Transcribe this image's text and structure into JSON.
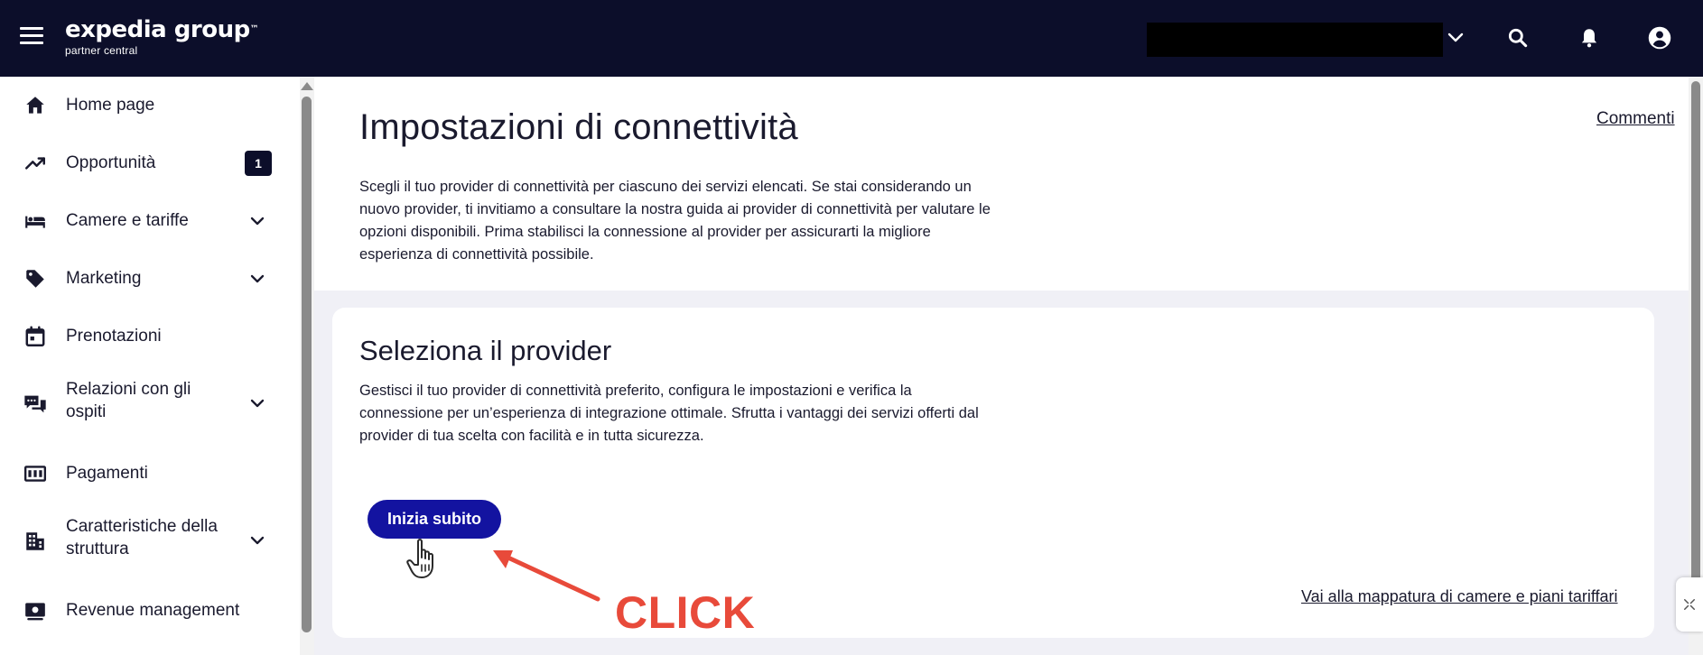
{
  "topbar": {
    "logo_main": "expedia group",
    "logo_tm": "™",
    "logo_sub": "partner central"
  },
  "sidebar": {
    "items": [
      {
        "label": "Home page",
        "icon": "home-icon"
      },
      {
        "label": "Opportunità",
        "icon": "trending-up-icon",
        "badge": "1"
      },
      {
        "label": "Camere e tariffe",
        "icon": "bed-icon",
        "expandable": true
      },
      {
        "label": "Marketing",
        "icon": "tag-icon",
        "expandable": true
      },
      {
        "label": "Prenotazioni",
        "icon": "calendar-icon"
      },
      {
        "label": "Relazioni con gli ospiti",
        "label_line1": "Relazioni con gli",
        "label_line2": "ospiti",
        "icon": "chat-icon",
        "expandable": true
      },
      {
        "label": "Pagamenti",
        "icon": "payments-icon"
      },
      {
        "label": "Caratteristiche della struttura",
        "label_line1": "Caratteristiche della",
        "label_line2": "struttura",
        "icon": "building-icon",
        "expandable": true
      },
      {
        "label": "Revenue management",
        "icon": "revenue-icon"
      }
    ]
  },
  "header": {
    "title": "Impostazioni di connettività",
    "description": "Scegli il tuo provider di connettività per ciascuno dei servizi elencati. Se stai considerando un nuovo provider, ti invitiamo a consultare la nostra guida ai provider di connettività per valutare le opzioni disponibili. Prima stabilisci la connessione al provider per assicurarti la migliore esperienza di connettività possibile.",
    "comments_link": "Commenti"
  },
  "card": {
    "title": "Seleziona il provider",
    "description": "Gestisci il tuo provider di connettività preferito, configura le impostazioni e verifica la connessione per un’esperienza di integrazione ottimale. Sfrutta i vantaggi dei servizi offerti dal provider di tua scelta con facilità e in tutta sicurezza.",
    "start_button": "Inizia subito",
    "mapping_link": "Vai alla mappatura di camere e piani tariffari"
  },
  "annotation": {
    "label": "CLICK",
    "color": "#e84a3a"
  },
  "colors": {
    "topbar_bg": "#0c0e2a",
    "primary_button": "#1313a0"
  }
}
